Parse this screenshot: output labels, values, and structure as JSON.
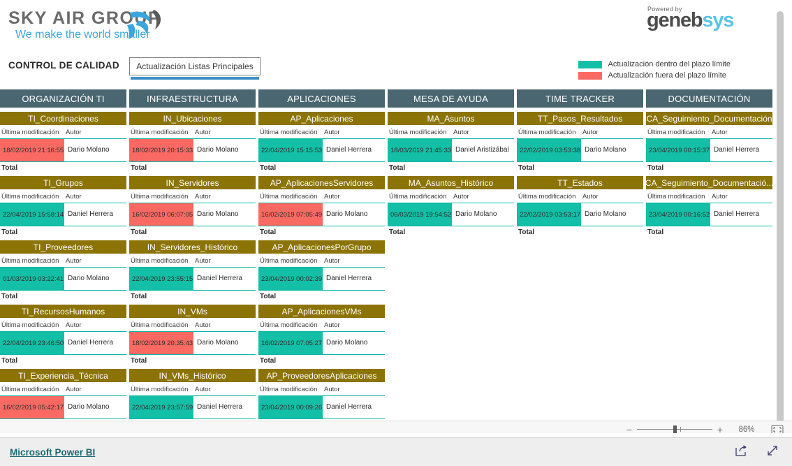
{
  "brand": {
    "logo_title": "SKY AIR GROUP",
    "logo_tagline": "We make the world smaller",
    "powered_by": "Powered by",
    "vendor_part1": "geneb",
    "vendor_part2": "sys"
  },
  "header": {
    "report_title": "CONTROL DE CALIDAD",
    "page_tab": "Actualización Listas Principales"
  },
  "legend": {
    "items": [
      {
        "label": "Actualización dentro del plazo límite",
        "color": "#13bfa6"
      },
      {
        "label": "Actualización fuera del plazo límite",
        "color": "#fa6a63"
      }
    ]
  },
  "card_labels": {
    "col_last_modified": "Última modificación",
    "col_author": "Autor",
    "total": "Total"
  },
  "columns": [
    {
      "header": "ORGANIZACIÓN TI",
      "cards": [
        {
          "title": "TI_Coordinaciones",
          "date": "18/02/2019 21:16:55",
          "status": "late",
          "author": "Dario Molano"
        },
        {
          "title": "TI_Grupos",
          "date": "22/04/2019 15:58:14",
          "status": "ok",
          "author": "Daniel Herrera"
        },
        {
          "title": "TI_Proveedores",
          "date": "01/03/2019 03:22:41",
          "status": "ok",
          "author": "Dario Molano"
        },
        {
          "title": "TI_RecursosHumanos",
          "date": "22/04/2019 23:46:50",
          "status": "ok",
          "author": "Daniel Herrera"
        },
        {
          "title": "TI_Experiencia_Técnica",
          "date": "16/02/2019 05:42:17",
          "status": "late",
          "author": "Dario Molano"
        }
      ]
    },
    {
      "header": "INFRAESTRUCTURA",
      "cards": [
        {
          "title": "IN_Ubicaciones",
          "date": "18/02/2019 20:15:33",
          "status": "late",
          "author": "Dario Molano"
        },
        {
          "title": "IN_Servidores",
          "date": "16/02/2019 06:07:05",
          "status": "late",
          "author": "Dario Molano"
        },
        {
          "title": "IN_Servidores_Histórico",
          "date": "22/04/2019 23:55:15",
          "status": "ok",
          "author": "Daniel Herrera"
        },
        {
          "title": "IN_VMs",
          "date": "18/02/2019 20:35:43",
          "status": "late",
          "author": "Dario Molano"
        },
        {
          "title": "IN_VMs_Histórico",
          "date": "22/04/2019 23:57:59",
          "status": "ok",
          "author": "Daniel Herrera"
        }
      ]
    },
    {
      "header": "APLICACIONES",
      "cards": [
        {
          "title": "AP_Aplicaciones",
          "date": "22/04/2019 15:15:53",
          "status": "ok",
          "author": "Daniel Herrera"
        },
        {
          "title": "AP_AplicacionesServidores",
          "date": "16/02/2019 07:05:49",
          "status": "late",
          "author": "Dario Molano"
        },
        {
          "title": "AP_AplicacionesPorGrupo",
          "date": "23/04/2019 00:02:39",
          "status": "ok",
          "author": "Daniel Herrera"
        },
        {
          "title": "AP_AplicacionesVMs",
          "date": "16/02/2019 07:05:27",
          "status": "ok",
          "author": "Dario Molano"
        },
        {
          "title": "AP_ProveedoresAplicaciones",
          "date": "23/04/2019 00:09:26",
          "status": "ok",
          "author": "Daniel Herrera"
        }
      ]
    },
    {
      "header": "MESA DE AYUDA",
      "cards": [
        {
          "title": "MA_Asuntos",
          "date": "18/03/2019 21:45:33",
          "status": "ok",
          "author": "Daniel Aristizábal"
        },
        {
          "title": "MA_Asuntos_Histórico",
          "date": "06/03/2019 19:54:52",
          "status": "ok",
          "author": "Dario Molano"
        }
      ]
    },
    {
      "header": "TIME TRACKER",
      "cards": [
        {
          "title": "TT_Pasos_Resultados",
          "date": "22/02/2019 03:53:38",
          "status": "ok",
          "author": "Dario Molano"
        },
        {
          "title": "TT_Estados",
          "date": "22/02/2019 03:53:17",
          "status": "ok",
          "author": "Dario Molano"
        }
      ]
    },
    {
      "header": "DOCUMENTACIÓN",
      "cards": [
        {
          "title": "CA_Seguimiento_Documentación",
          "date": "23/04/2019 00:15:37",
          "status": "ok",
          "author": "Daniel Herrera"
        },
        {
          "title": "CA_Seguimiento_Documentació...",
          "date": "23/04/2019 00:16:52",
          "status": "ok",
          "author": "Daniel Herrera"
        }
      ]
    }
  ],
  "zoombar": {
    "minus": "−",
    "plus": "+",
    "zoom_value": "86%"
  },
  "footer": {
    "powerbi_link": "Microsoft Power BI"
  },
  "colors": {
    "column_header_bg": "#4a6670",
    "card_title_bg": "#8b7306",
    "ok": "#13bfa6",
    "late": "#fa6a63",
    "tab_underline": "#3b8fc4"
  }
}
